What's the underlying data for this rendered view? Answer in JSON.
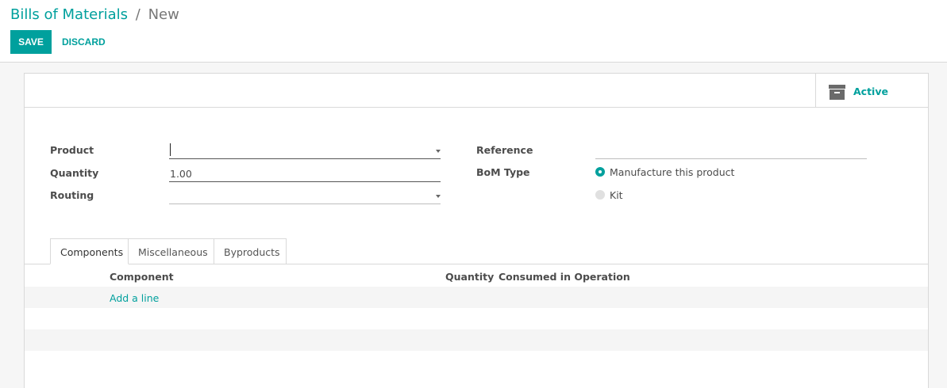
{
  "breadcrumb": {
    "parent": "Bills of Materials",
    "separator": "/",
    "current": "New"
  },
  "toolbar": {
    "save_label": "SAVE",
    "discard_label": "DISCARD"
  },
  "stat_button": {
    "label": "Active",
    "icon": "archive-icon"
  },
  "form": {
    "product_label": "Product",
    "product_value": "",
    "quantity_label": "Quantity",
    "quantity_value": "1.00",
    "routing_label": "Routing",
    "routing_value": "",
    "reference_label": "Reference",
    "reference_value": "",
    "bom_type_label": "BoM Type",
    "bom_type_options": [
      {
        "label": "Manufacture this product",
        "selected": true
      },
      {
        "label": "Kit",
        "selected": false
      }
    ]
  },
  "tabs": [
    {
      "label": "Components",
      "active": true
    },
    {
      "label": "Miscellaneous",
      "active": false
    },
    {
      "label": "Byproducts",
      "active": false
    }
  ],
  "table": {
    "headers": [
      "Component",
      "Quantity",
      "Consumed in Operation"
    ],
    "add_line_label": "Add a line"
  },
  "colors": {
    "accent": "#00a09d",
    "row_stripe": "#f5f5f5"
  }
}
